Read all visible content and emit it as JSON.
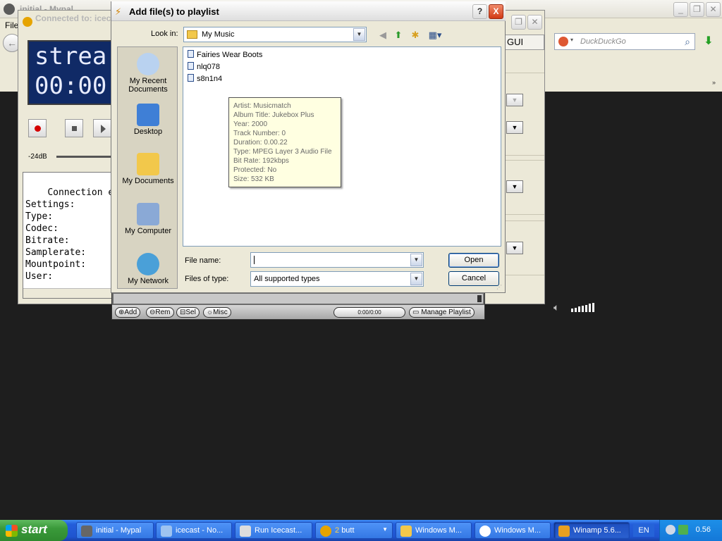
{
  "mypal": {
    "title": "initial - Mypal",
    "menu_file": "File",
    "search_placeholder": "DuckDuckGo"
  },
  "butt": {
    "title": "Connected to: icecast",
    "lcd_line1": "strea",
    "lcd_line2": "00:00",
    "gain_label": "-24dB",
    "log_lines": "Connection est\nSettings:\nType:\nCodec:\nBitrate:\nSamplerate:\nMountpoint:\nUser:",
    "gui_tab": "GUI"
  },
  "dialog": {
    "title": "Add file(s) to playlist",
    "look_in_label": "Look in:",
    "look_in_value": "My Music",
    "places": [
      {
        "label": "My Recent Documents"
      },
      {
        "label": "Desktop"
      },
      {
        "label": "My Documents"
      },
      {
        "label": "My Computer"
      },
      {
        "label": "My Network"
      }
    ],
    "files": [
      "Fairies Wear Boots",
      "nlq078",
      "s8n1n4"
    ],
    "tooltip": [
      "Artist: Musicmatch",
      "Album Title: Jukebox Plus",
      "Year: 2000",
      "Track Number: 0",
      "Duration: 0.00.22",
      "Type: MPEG Layer 3 Audio File",
      "Bit Rate: 192kbps",
      "Protected: No",
      "Size: 532 KB"
    ],
    "file_name_label": "File name:",
    "file_name_value": "",
    "files_of_type_label": "Files of type:",
    "files_of_type_value": "All supported types",
    "open_label": "Open",
    "cancel_label": "Cancel",
    "help_label": "?",
    "close_label": "X"
  },
  "playlist": {
    "add": "Add",
    "rem": "Rem",
    "sel": "Sel",
    "misc": "Misc",
    "time": "0:00/0:00",
    "manage": "Manage Playlist"
  },
  "taskbar": {
    "start": "start",
    "tasks": [
      {
        "label": "initial - Mypal"
      },
      {
        "label": "icecast - No..."
      },
      {
        "label": "Run Icecast..."
      },
      {
        "count": "2",
        "label": "butt"
      },
      {
        "label": "Windows M..."
      },
      {
        "label": "Windows M..."
      },
      {
        "label": "Winamp 5.6..."
      }
    ],
    "lang": "EN",
    "clock": "0.56"
  },
  "colors": {
    "xp_blue": "#245edb",
    "start_green": "#3a9a3a",
    "tooltip_bg": "#ffffe1",
    "lcd_bg": "#102a66"
  }
}
